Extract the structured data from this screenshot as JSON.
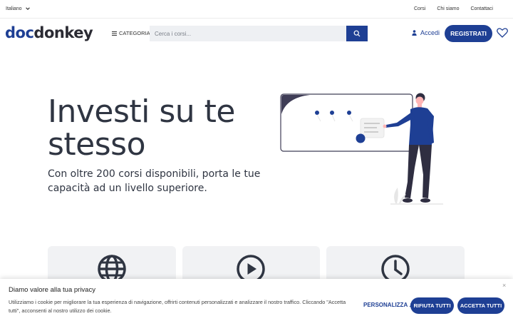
{
  "topbar": {
    "language": "Italiano",
    "links": [
      "Corsi",
      "Chi siamo",
      "Contattaci"
    ]
  },
  "header": {
    "logo_part1": "doc",
    "logo_part2": "donkey",
    "category_label": "CATEGORIA",
    "search_placeholder": "Cerca i corsi...",
    "login_label": "Accedi",
    "register_label": "REGISTRATI"
  },
  "hero": {
    "title": "Investi su te stesso",
    "subtitle": "Con oltre 200 corsi disponibili, porta le tue capacità ad un livello superiore."
  },
  "features": {
    "icons": [
      "globe-icon",
      "play-circle-icon",
      "clock-icon"
    ]
  },
  "cookie": {
    "title": "Diamo valore alla tua privacy",
    "text": "Utilizziamo i cookie per migliorare la tua esperienza di navigazione, offrirti contenuti personalizzati e analizzare il nostro traffico. Cliccando \"Accetta tutti\", acconsenti al nostro utilizzo dei cookie.",
    "close": "×",
    "customize_label": "PERSONALIZZA",
    "reject_label": "RIFIUTA TUTTI",
    "accept_label": "ACCETTA TUTTI"
  },
  "colors": {
    "brand": "#1e3f94",
    "text": "#2f3542",
    "card_bg": "#f1f2f4"
  }
}
